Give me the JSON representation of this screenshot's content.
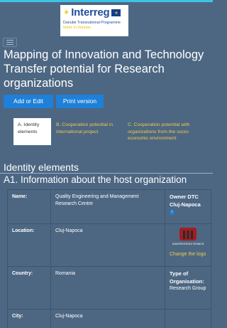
{
  "header": {
    "logo": {
      "name": "Interreg",
      "line1": "Danube Transnational Programme",
      "line2": "Made in Danube"
    }
  },
  "page": {
    "title": "Mapping of Innovation and Technology Transfer potential for Research organizations"
  },
  "actions": {
    "add_edit_label": "Add or Edit",
    "print_label": "Print version"
  },
  "tabs": [
    {
      "label": "A. Identity elements"
    },
    {
      "label": "B. Cooperation potential in international project"
    },
    {
      "label": "C. Cooperation potential with organizations from the socio-economic environment"
    }
  ],
  "section": {
    "title": "Identity elements",
    "subtitle": "A1. Information about the host organization"
  },
  "table": {
    "name_label": "Name:",
    "name_value": "Quality Engineering and Management Research Centre",
    "owner_label": "Owner DTC Cluj-Napoca",
    "location_label": "Location:",
    "location_value": "Cluj-Napoca",
    "uni_logo_text": "UNIVERSITATEA TEHNICĂ",
    "change_logo": "Change the logo",
    "country_label": "Country:",
    "country_value": "Romania",
    "type_label": "Type of Organisation:",
    "type_value": "Research Group",
    "city_label": "City:",
    "city_value": "Cluj-Napoca"
  },
  "colors": {
    "background": "#4d6783",
    "accent": "#1e80d8",
    "link": "#f2c94c"
  }
}
